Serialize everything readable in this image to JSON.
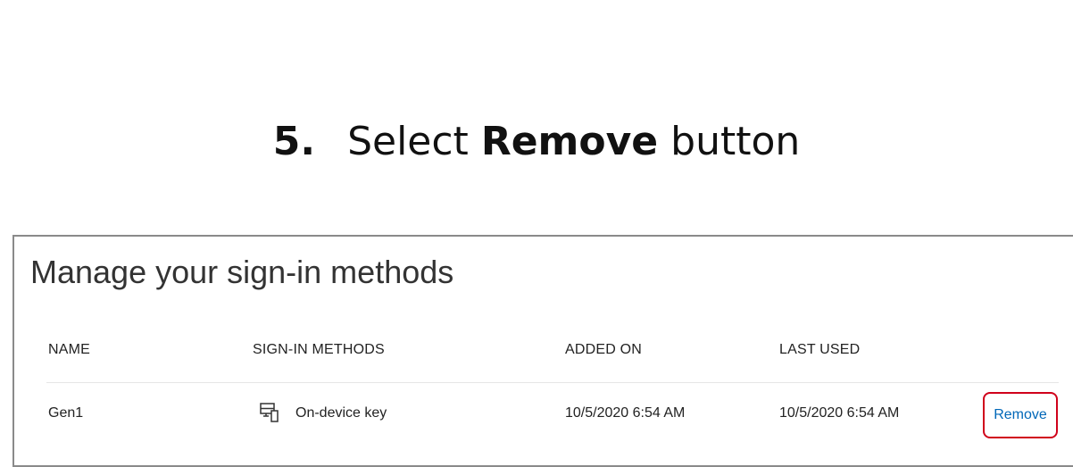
{
  "instruction": {
    "step": "5.",
    "prefix": "Select",
    "bold_word": "Remove",
    "suffix": "button"
  },
  "panel": {
    "title": "Manage your sign-in methods",
    "columns": [
      "NAME",
      "SIGN-IN METHODS",
      "ADDED ON",
      "LAST USED"
    ],
    "rows": [
      {
        "name": "Gen1",
        "method": "On-device key",
        "method_icon": "device-key-icon",
        "added_on": "10/5/2020 6:54 AM",
        "last_used": "10/5/2020 6:54 AM",
        "action": "Remove"
      }
    ]
  },
  "colors": {
    "highlight": "#d0021b",
    "link": "#0067b8"
  }
}
